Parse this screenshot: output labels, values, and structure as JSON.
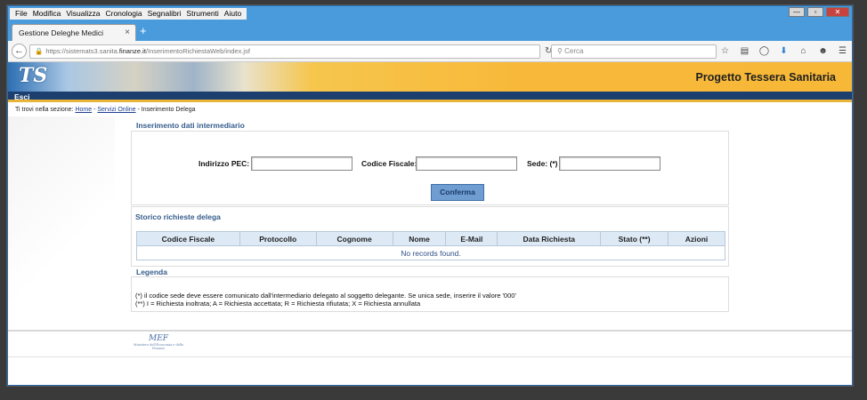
{
  "menu": [
    "File",
    "Modifica",
    "Visualizza",
    "Cronologia",
    "Segnalibri",
    "Strumenti",
    "Aiuto"
  ],
  "window_controls": {
    "minimize": "—",
    "restore": "▫",
    "close": "✕"
  },
  "tab": {
    "title": "Gestione Deleghe Medici",
    "close": "×",
    "new": "+"
  },
  "address": {
    "prefix": "https://sistemats3.sanita.",
    "domain": "finanze.it",
    "path": "/InserimentoRichiestaWeb/index.jsf"
  },
  "search": {
    "placeholder": "Cerca"
  },
  "nav_icons": [
    "star-icon",
    "reading-list-icon",
    "pocket-icon",
    "download-icon",
    "home-icon",
    "chat-icon",
    "menu-icon"
  ],
  "site": {
    "logo": "TS",
    "title": "Progetto Tessera Sanitaria",
    "esci": "Esci"
  },
  "breadcrumb": {
    "prefix": "Ti trovi nella sezione:",
    "home": "Home",
    "sep": " - ",
    "servizi": "Servizi Online",
    "current": "Inserimento Delega"
  },
  "form": {
    "title": "Inserimento dati intermediario",
    "pec_label": "Indirizzo PEC:",
    "cf_label": "Codice Fiscale:",
    "sede_label": "Sede: (*)",
    "pec_value": "",
    "cf_value": "",
    "sede_value": "",
    "submit": "Conferma"
  },
  "storico": {
    "title": "Storico richieste delega",
    "columns": [
      "Codice Fiscale",
      "Protocollo",
      "Cognome",
      "Nome",
      "E-Mail",
      "Data Richiesta",
      "Stato (**)",
      "Azioni"
    ],
    "empty": "No records found."
  },
  "legenda": {
    "title": "Legenda",
    "line1": "(*) il codice sede deve essere comunicato dall'intermediario delegato al soggetto delegante. Se unica sede, inserire il valore '000'",
    "line2": "(**) I = Richiesta inoltrata; A = Richiesta accettata; R = Richiesta rifiutata; X = Richiesta annullata"
  },
  "footer": {
    "logo": "MEF",
    "caption": "Ministero dell'Economia e delle Finanze"
  },
  "colors": {
    "chrome": "#4a9bdc",
    "header_navy": "#1d3f6f",
    "accent": "#f8b93a",
    "button": "#6f9dd2"
  }
}
